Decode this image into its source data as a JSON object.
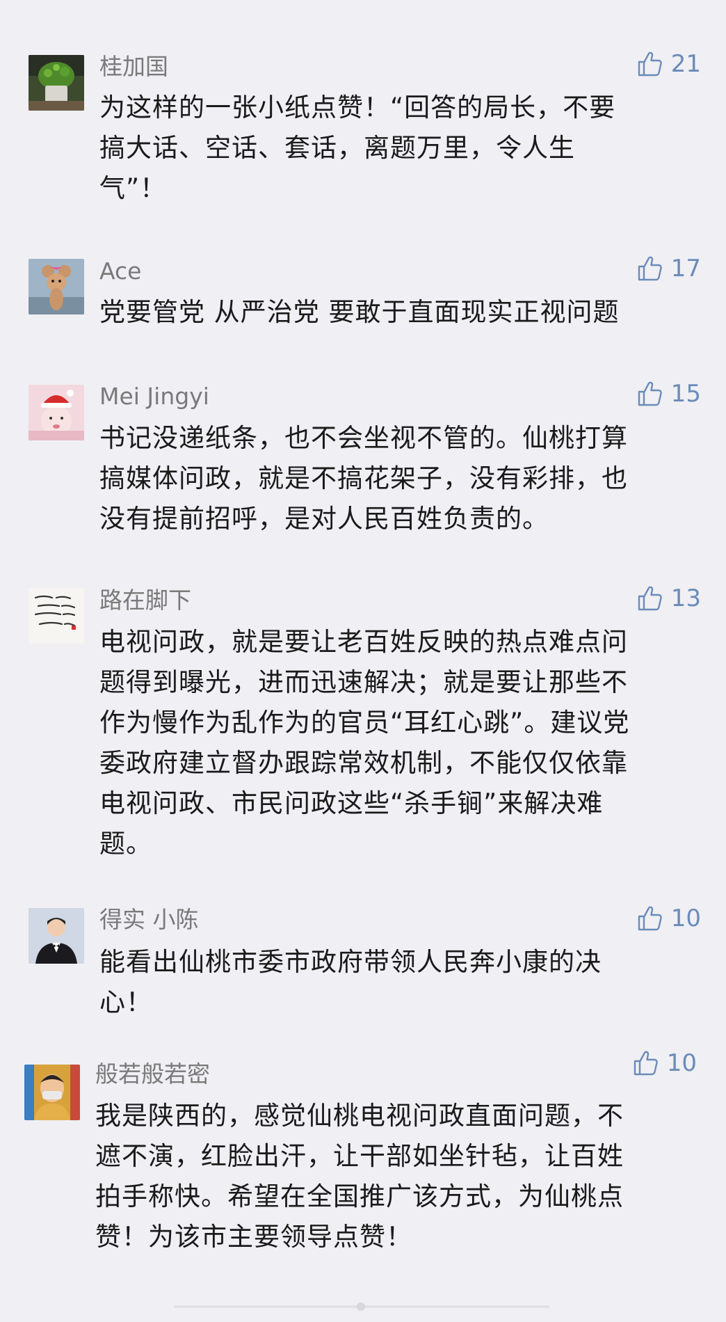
{
  "colors": {
    "background": "#efeff4",
    "name": "#7a7a7a",
    "like": "#6b8bb8",
    "text": "#1a1a1a"
  },
  "comments": [
    {
      "name": "桂加国",
      "likes": "21",
      "avatar_icon": "plant-photo-avatar",
      "lines": [
        "为这样的一张小纸点赞！“回答的局长，不要",
        "搞大话、空话、套话，离题万里，令人生",
        "气”！"
      ]
    },
    {
      "name": "Ace",
      "likes": "17",
      "avatar_icon": "cartoon-mouse-avatar",
      "lines": [
        "党要管党 从严治党 要敢于直面现实正视问题"
      ]
    },
    {
      "name": "Mei Jingyi",
      "likes": "15",
      "avatar_icon": "santa-hat-girl-avatar",
      "lines": [
        "书记没递纸条，也不会坐视不管的。仙桃打算",
        "搞媒体问政，就是不搞花架子，没有彩排，也",
        "没有提前招呼，是对人民百姓负责的。"
      ]
    },
    {
      "name": "路在脚下",
      "likes": "13",
      "avatar_icon": "calligraphy-avatar",
      "lines": [
        "电视问政，就是要让老百姓反映的热点难点问",
        "题得到曝光，进而迅速解决；就是要让那些不",
        "作为慢作为乱作为的官员“耳红心跳”。建议党",
        "委政府建立督办跟踪常效机制，不能仅仅依靠",
        "电视问政、市民问政这些“杀手锏”来解决难",
        "题。"
      ]
    },
    {
      "name": "得实 小陈",
      "likes": "10",
      "avatar_icon": "man-in-suit-avatar",
      "lines": [
        "能看出仙桃市委市政府带领人民奔小康的决",
        "心！"
      ]
    },
    {
      "name": "般若般若密",
      "likes": "10",
      "avatar_icon": "masked-person-avatar",
      "lines": [
        "我是陕西的，感觉仙桃电视问政直面问题，不",
        "遮不演，红脸出汗，让干部如坐针毡，让百姓",
        "拍手称快。希望在全国推广该方式，为仙桃点",
        "赞！为该市主要领导点赞！"
      ]
    }
  ]
}
